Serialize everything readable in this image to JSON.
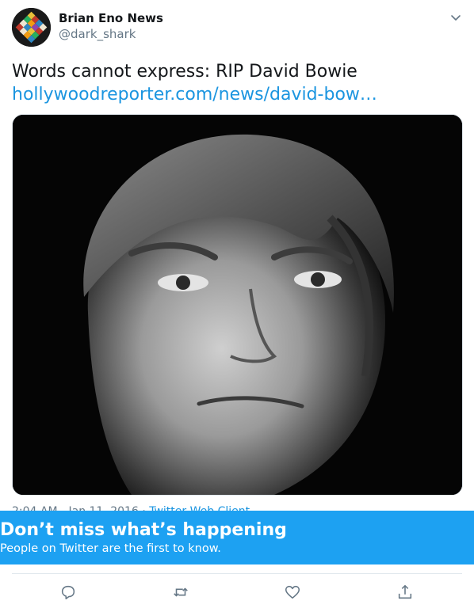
{
  "author": {
    "name": "Brian Eno News",
    "handle": "@dark_shark",
    "avatar_icon": "mosaic-avatar"
  },
  "tweet": {
    "text": "Words cannot express: RIP David Bowie",
    "link": "hollywoodreporter.com/news/david-bow…",
    "photo_icon": "portrait-photo",
    "timestamp": "2:04 AM - Jan 11, 2016",
    "source": "Twitter Web Client"
  },
  "banner": {
    "title": "Don’t miss what’s happening",
    "subtitle": "People on Twitter are the first to know."
  },
  "actions": [
    "reply-icon",
    "retweet-icon",
    "like-icon",
    "share-icon"
  ],
  "colors": {
    "link": "#1b95e0",
    "banner": "#1da1f2",
    "icon": "#657786",
    "divider": "#e1e8ed"
  }
}
